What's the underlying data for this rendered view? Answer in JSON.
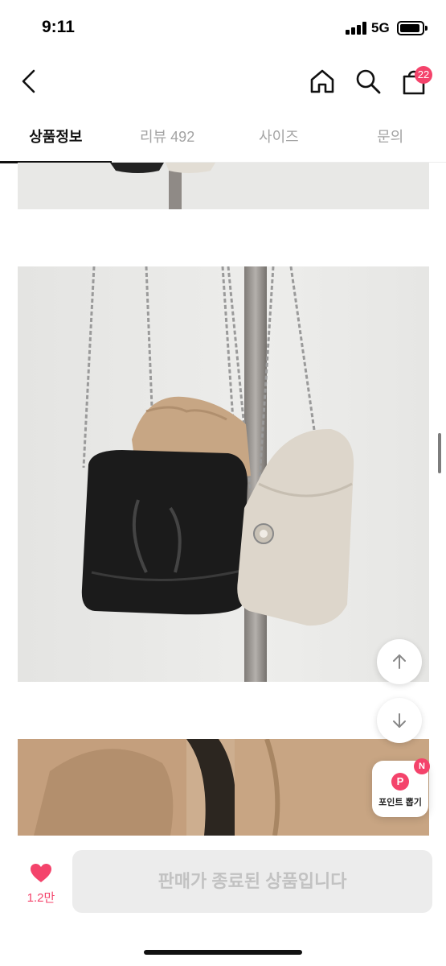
{
  "status_bar": {
    "time": "9:11",
    "network": "5G"
  },
  "header": {
    "back_icon": "chevron-left-icon",
    "home_icon": "home-icon",
    "search_icon": "search-icon",
    "cart_icon": "shopping-bag-icon",
    "cart_count": "22"
  },
  "tabs": [
    {
      "label": "상품정보",
      "active": true
    },
    {
      "label": "리뷰 492",
      "active": false
    },
    {
      "label": "사이즈",
      "active": false
    },
    {
      "label": "문의",
      "active": false
    }
  ],
  "floating": {
    "up_icon": "arrow-up-icon",
    "down_icon": "arrow-down-icon",
    "point_badge": "P",
    "point_label": "포인트 뽑기",
    "point_new": "N"
  },
  "bottom_bar": {
    "like_icon": "heart-icon",
    "like_count": "1.2만",
    "sold_out_label": "판매가 종료된 상품입니다"
  },
  "colors": {
    "accent": "#f4436b",
    "disabled_bg": "#ececec",
    "disabled_text": "#c2c2c2"
  }
}
